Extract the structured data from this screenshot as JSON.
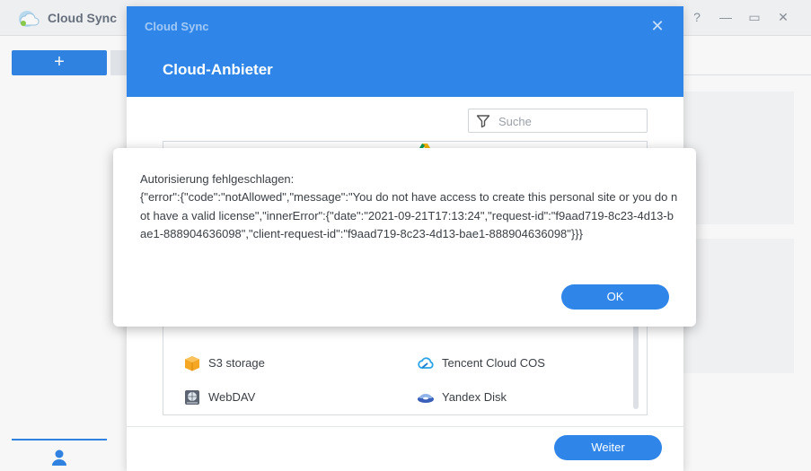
{
  "app": {
    "title": "Cloud Sync",
    "controls": {
      "help": "?",
      "minimize": "—",
      "maximize": "▭",
      "close": "✕"
    },
    "add_label": "+"
  },
  "modal": {
    "app_name": "Cloud Sync",
    "title": "Cloud-Anbieter",
    "close_label": "✕",
    "search": {
      "placeholder": "Suche",
      "value": ""
    },
    "providers": [
      {
        "name": "S3 storage",
        "icon": "s3-box-icon"
      },
      {
        "name": "Tencent Cloud COS",
        "icon": "tencent-cloud-icon"
      },
      {
        "name": "WebDAV",
        "icon": "webdav-globe-icon"
      },
      {
        "name": "Yandex Disk",
        "icon": "yandex-disk-icon"
      }
    ],
    "next_label": "Weiter"
  },
  "error_dialog": {
    "message": "Autorisierung fehlgeschlagen:\n{\"error\":{\"code\":\"notAllowed\",\"message\":\"You do not have access to create this personal site or you do not have a valid license\",\"innerError\":{\"date\":\"2021-09-21T17:13:24\",\"request-id\":\"f9aad719-8c23-4d13-bae1-888904636098\",\"client-request-id\":\"f9aad719-8c23-4d13-bae1-888904636098\"}}}",
    "ok_label": "OK"
  },
  "colors": {
    "accent": "#2f86e8",
    "text": "#3a3f45"
  }
}
